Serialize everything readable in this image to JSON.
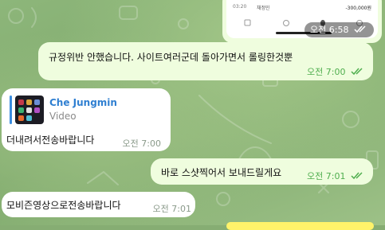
{
  "screenshot_preview": {
    "row_time": "03:20",
    "row_name": "채정민",
    "row_amount": "-300,000원",
    "time": "오전 6:58",
    "read_ticks": "double-check-icon"
  },
  "messages": [
    {
      "direction": "out",
      "text": "규정위반 안했습니다. 사이트여러군데 돌아가면서 롤링한것뿐",
      "time": "오전 7:00",
      "status": "read"
    },
    {
      "direction": "in",
      "reply": {
        "name": "Che Jungmin",
        "type": "Video"
      },
      "text": "더내려서전송바랍니다",
      "time": "오전 7:00"
    },
    {
      "direction": "out",
      "text": "바로 스샷찍어서 보내드릴게요",
      "time": "오전 7:01",
      "status": "read"
    },
    {
      "direction": "in",
      "text": "모비즌영상으로전송바랍니다",
      "time": "오전 7:01"
    }
  ],
  "colors": {
    "outgoing_bubble": "#effdde",
    "incoming_bubble": "#ffffff",
    "tick_green": "#4fae4e",
    "reply_accent": "#2f7fd1",
    "background": "#86ad73"
  }
}
